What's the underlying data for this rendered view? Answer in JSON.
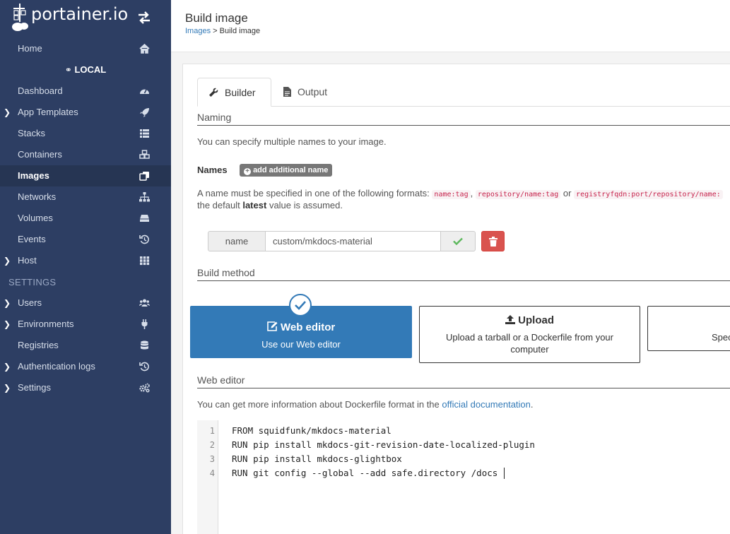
{
  "app": {
    "logo_text": "portainer.io"
  },
  "sidebar": {
    "home": "Home",
    "environment": "LOCAL",
    "items": [
      {
        "label": "Dashboard",
        "icon": "tachometer-icon"
      },
      {
        "label": "App Templates",
        "icon": "rocket-icon"
      },
      {
        "label": "Stacks",
        "icon": "th-list-icon"
      },
      {
        "label": "Containers",
        "icon": "cubes-icon"
      },
      {
        "label": "Images",
        "icon": "clone-icon"
      },
      {
        "label": "Networks",
        "icon": "sitemap-icon"
      },
      {
        "label": "Volumes",
        "icon": "hdd-icon"
      },
      {
        "label": "Events",
        "icon": "history-icon"
      },
      {
        "label": "Host",
        "icon": "th-icon"
      }
    ],
    "settings_section": "SETTINGS",
    "settings_items": [
      {
        "label": "Users",
        "icon": "users-icon"
      },
      {
        "label": "Environments",
        "icon": "plug-icon"
      },
      {
        "label": "Registries",
        "icon": "database-icon"
      },
      {
        "label": "Authentication logs",
        "icon": "history-icon"
      },
      {
        "label": "Settings",
        "icon": "cogs-icon"
      }
    ]
  },
  "header": {
    "title": "Build image",
    "breadcrumb_link": "Images",
    "breadcrumb_sep": ">",
    "breadcrumb_current": "Build image"
  },
  "tabs": {
    "builder": "Builder",
    "output": "Output"
  },
  "naming": {
    "title": "Naming",
    "description": "You can specify multiple names to your image.",
    "names_label": "Names",
    "add_name_button": "add additional name",
    "format_text_1": "A name must be specified in one of the following formats:",
    "format_1": "name:tag",
    "format_sep": ",",
    "format_2": "repository/name:tag",
    "format_or": "or",
    "format_3": "registryfqdn:port/repository/name:",
    "format_text_2a": "the default",
    "format_text_bold": "latest",
    "format_text_2b": "value is assumed.",
    "name_addon": "name",
    "name_value": "custom/mkdocs-material"
  },
  "build_method": {
    "title": "Build method",
    "web_editor_title": "Web editor",
    "web_editor_desc": "Use our Web editor",
    "upload_title": "Upload",
    "upload_desc_1": "Upload a tarball or a Dockerfile from your",
    "upload_desc_2": "computer",
    "remote_desc": "Spec"
  },
  "web_editor": {
    "title": "Web editor",
    "info_prefix": "You can get more information about Dockerfile format in the",
    "info_link": "official documentation",
    "info_suffix": ".",
    "lines": [
      {
        "n": "1",
        "code": "FROM squidfunk/mkdocs-material"
      },
      {
        "n": "2",
        "code": "RUN pip install mkdocs-git-revision-date-localized-plugin"
      },
      {
        "n": "3",
        "code": "RUN pip install mkdocs-glightbox"
      },
      {
        "n": "4",
        "code": "RUN git config --global --add safe.directory /docs"
      }
    ]
  },
  "colors": {
    "sidebar": "#2d3e63",
    "primary": "#337ab7",
    "danger": "#d9534f",
    "success": "#5cb85c"
  }
}
